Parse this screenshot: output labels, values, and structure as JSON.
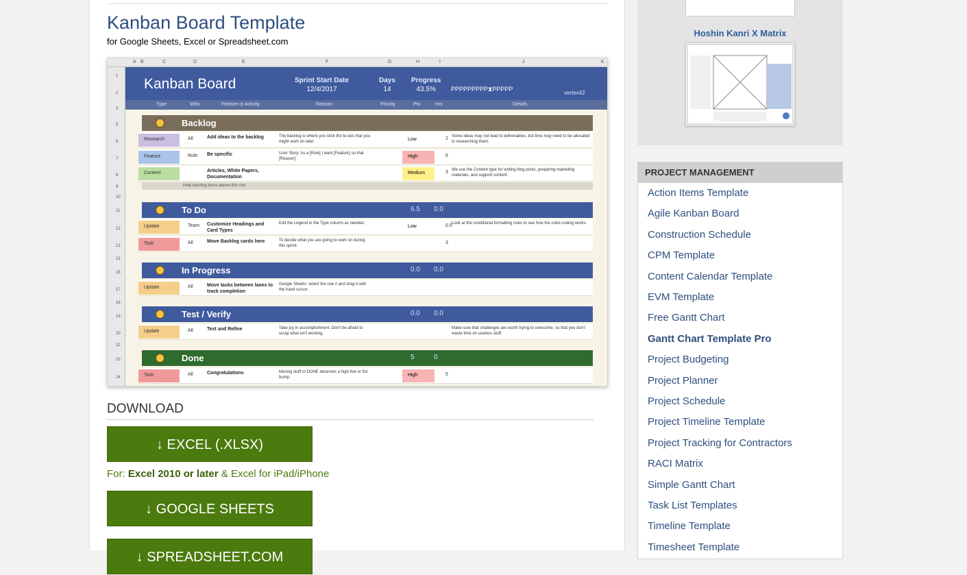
{
  "main": {
    "title": "Kanban Board Template",
    "subtitle": "for Google Sheets, Excel or Spreadsheet.com"
  },
  "preview": {
    "columns": [
      "A",
      "B",
      "C",
      "D",
      "E",
      "F",
      "G",
      "H",
      "I",
      "J",
      "K"
    ],
    "rows": [
      "1",
      "2",
      "3",
      "5",
      "6",
      "7",
      "8",
      "9",
      "10",
      "11",
      "12",
      "13",
      "15",
      "16",
      "17",
      "18",
      "19",
      "20",
      "22",
      "23",
      "24"
    ],
    "board_title": "Kanban Board",
    "sprint_label": "Sprint Start Date",
    "sprint_value": "12/4/2017",
    "days_label": "Days",
    "days_value": "14",
    "progress_label": "Progress",
    "progress_value": "43.5%",
    "flags": "PPPPPPPPP⧗PPPPP",
    "logo": "vertex42",
    "col_names": [
      "Type",
      "Who",
      "Feature or Activity",
      "Reason",
      "Priority",
      "Pts",
      "Hrs",
      "Details"
    ],
    "hide_bar": "Hide backlog items above this row",
    "sections": [
      {
        "label": "Backlog",
        "n1": "",
        "n2": "",
        "color": "#7a6e5a"
      },
      {
        "label": "To Do",
        "n1": "6.5",
        "n2": "0.0",
        "color": "#3f5b9e"
      },
      {
        "label": "In Progress",
        "n1": "0.0",
        "n2": "0.0",
        "color": "#3f5b9e"
      },
      {
        "label": "Test / Verify",
        "n1": "0.0",
        "n2": "0.0",
        "color": "#3f5b9e"
      },
      {
        "label": "Done",
        "n1": "5",
        "n2": "0",
        "color": "#2f6b2f"
      }
    ],
    "rows_data": [
      {
        "type": "Research",
        "type_color": "#c9bfe0",
        "who": "All",
        "title": "Add ideas to the backlog",
        "reason": "The backlog is where you stick the to-dos that you might work on later.",
        "prio": "Low",
        "prio_color": "#ffffff",
        "pts": "2",
        "details": "Some ideas may not lead to deliverables, but time may need to be allocated to researching them."
      },
      {
        "type": "Feature",
        "type_color": "#a9c4e8",
        "who": "Role",
        "title": "Be specific",
        "reason": "User Story: As a [Role] I want [Feature] so that [Reason]",
        "prio": "High",
        "prio_color": "#f8b4b4",
        "pts": "6",
        "details": ""
      },
      {
        "type": "Content",
        "type_color": "#b9dea0",
        "who": "",
        "title": "Articles, White Papers, Documentation",
        "reason": "",
        "prio": "Medium",
        "prio_color": "#fff08a",
        "pts": "3",
        "details": "We use the Content type for writing blog posts, preparing marketing materials, and support content."
      },
      {
        "type": "Update",
        "type_color": "#f5cf8a",
        "who": "Team",
        "title": "Customize Headings and Card Types",
        "reason": "Edit the Legend in the Type column as needed.",
        "prio": "Low",
        "prio_color": "#ffffff",
        "pts": "0.5",
        "details": "Look at the conditional formatting rules to see how the color-coding works."
      },
      {
        "type": "Task",
        "type_color": "#ef9a9a",
        "who": "All",
        "title": "Move Backlog cards here",
        "reason": "To decide what you are going to work on during this sprint.",
        "prio": "",
        "prio_color": "#ffffff",
        "pts": "3",
        "details": ""
      },
      {
        "type": "Update",
        "type_color": "#f5cf8a",
        "who": "All",
        "title": "Move tasks between lanes to track completion",
        "reason": "Google Sheets: select the row # and drag it with the hand cursor.",
        "prio": "",
        "prio_color": "#ffffff",
        "pts": "",
        "details": ""
      },
      {
        "type": "Update",
        "type_color": "#f5cf8a",
        "who": "All",
        "title": "Test and Refine",
        "reason": "Take joy in accomplishment. Don't be afraid to scrap what isn't working.",
        "prio": "",
        "prio_color": "#ffffff",
        "pts": "",
        "details": "Make sure that challenges are worth trying to overcome, so that you don't waste time on useless stuff."
      },
      {
        "type": "Task",
        "type_color": "#ef9a9a",
        "who": "All",
        "title": "Congratulations",
        "reason": "Moving stuff to DONE deserves a high five or fist bump.",
        "prio": "High",
        "prio_color": "#f8b4b4",
        "pts": "5",
        "details": ""
      }
    ]
  },
  "download": {
    "heading": "DOWNLOAD",
    "excel_label": "↓ EXCEL (.XLSX)",
    "note_prefix": "For: ",
    "note_bold": "Excel 2010 or later",
    "note_suffix": " & Excel for iPad/iPhone",
    "sheets_label": "↓ GOOGLE SHEETS",
    "spreadsheet_label": "↓ SPREADSHEET.COM"
  },
  "sidebar": {
    "thumb_title": "Hoshin Kanri X Matrix",
    "pm_heading": "PROJECT MANAGEMENT",
    "links": [
      {
        "label": "Action Items Template",
        "active": false
      },
      {
        "label": "Agile Kanban Board",
        "active": false
      },
      {
        "label": "Construction Schedule",
        "active": false
      },
      {
        "label": "CPM Template",
        "active": false
      },
      {
        "label": "Content Calendar Template",
        "active": false
      },
      {
        "label": "EVM Template",
        "active": false
      },
      {
        "label": "Free Gantt Chart",
        "active": false
      },
      {
        "label": "Gantt Chart Template Pro",
        "active": true
      },
      {
        "label": "Project Budgeting",
        "active": false
      },
      {
        "label": "Project Planner",
        "active": false
      },
      {
        "label": "Project Schedule",
        "active": false
      },
      {
        "label": "Project Timeline Template",
        "active": false
      },
      {
        "label": "Project Tracking for Contractors",
        "active": false
      },
      {
        "label": "RACI Matrix",
        "active": false
      },
      {
        "label": "Simple Gantt Chart",
        "active": false
      },
      {
        "label": "Task List Templates",
        "active": false
      },
      {
        "label": "Timeline Template",
        "active": false
      },
      {
        "label": "Timesheet Template",
        "active": false
      }
    ]
  }
}
